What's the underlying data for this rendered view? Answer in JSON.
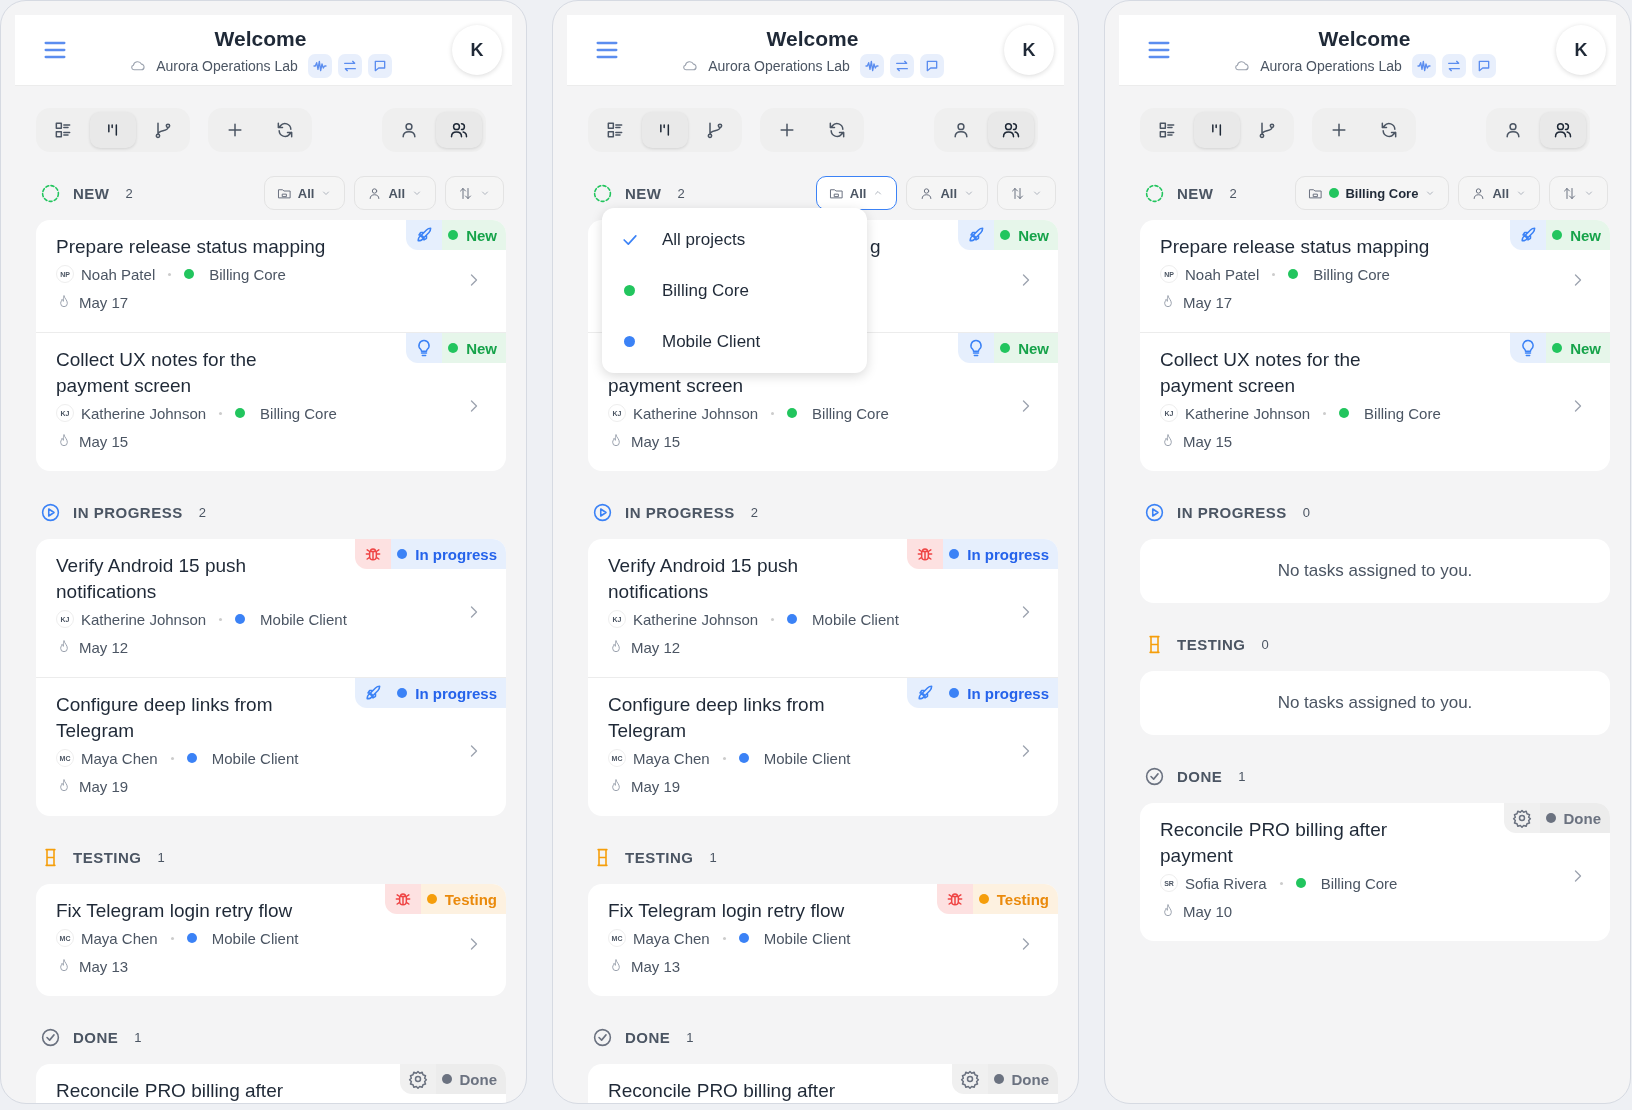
{
  "panels": [
    {
      "header": {
        "title": "Welcome",
        "workspace": "Aurora Operations Lab",
        "avatar": "K",
        "actions": [
          {
            "kind": "wave"
          },
          {
            "kind": "swap"
          },
          {
            "kind": "chat"
          }
        ]
      },
      "toolbar": [
        {
          "items": [
            {
              "kind": "list",
              "selected": false
            },
            {
              "kind": "board",
              "selected": true
            },
            {
              "kind": "branch",
              "selected": false
            }
          ]
        },
        {
          "items": [
            {
              "kind": "add",
              "selected": false
            },
            {
              "kind": "refresh",
              "selected": false
            }
          ]
        },
        {
          "items": [
            {
              "kind": "person",
              "selected": false
            },
            {
              "kind": "people",
              "selected": true
            }
          ]
        }
      ],
      "filters": {
        "project": {
          "value": "All",
          "open": false
        },
        "assignee": {
          "value": "All"
        }
      },
      "sections": [
        {
          "kind": "new",
          "label": "NEW",
          "count": "2",
          "tasks": [
            {
              "title": "Prepare release status mapping",
              "kind": "rocket",
              "status": {
                "kind": "new",
                "label": "New"
              },
              "initials": "NP",
              "assignee": "Noah Patel",
              "project": "Billing Core",
              "color": "#22c55e",
              "date": "May 17"
            },
            {
              "title": "Collect UX notes for the payment screen",
              "kind": "bulb",
              "status": {
                "kind": "new",
                "label": "New"
              },
              "initials": "KJ",
              "assignee": "Katherine Johnson",
              "project": "Billing Core",
              "color": "#22c55e",
              "date": "May 15"
            }
          ]
        },
        {
          "kind": "progress",
          "label": "IN PROGRESS",
          "count": "2",
          "tasks": [
            {
              "title": "Verify Android 15 push notifications",
              "kind": "bug",
              "status": {
                "kind": "progress",
                "label": "In progress"
              },
              "initials": "KJ",
              "assignee": "Katherine Johnson",
              "project": "Mobile Client",
              "color": "#3b82f6",
              "date": "May 12"
            },
            {
              "title": "Configure deep links from Telegram",
              "kind": "rocket",
              "status": {
                "kind": "progress",
                "label": "In progress"
              },
              "initials": "MC",
              "assignee": "Maya Chen",
              "project": "Mobile Client",
              "color": "#3b82f6",
              "date": "May 19"
            }
          ]
        },
        {
          "kind": "testing",
          "label": "TESTING",
          "count": "1",
          "tasks": [
            {
              "title": "Fix Telegram login retry flow",
              "kind": "bug",
              "status": {
                "kind": "testing",
                "label": "Testing"
              },
              "initials": "MC",
              "assignee": "Maya Chen",
              "project": "Mobile Client",
              "color": "#3b82f6",
              "date": "May 13"
            }
          ]
        },
        {
          "kind": "done",
          "label": "DONE",
          "count": "1",
          "tasks": [
            {
              "title": "Reconcile PRO billing after",
              "kind": "gear",
              "status": {
                "kind": "done",
                "label": "Done"
              }
            }
          ]
        }
      ]
    },
    {
      "header": {
        "title": "Welcome",
        "workspace": "Aurora Operations Lab",
        "avatar": "K",
        "actions": [
          {
            "kind": "wave"
          },
          {
            "kind": "swap"
          },
          {
            "kind": "chat"
          }
        ]
      },
      "toolbar": [
        {
          "items": [
            {
              "kind": "list",
              "selected": false
            },
            {
              "kind": "board",
              "selected": true
            },
            {
              "kind": "branch",
              "selected": false
            }
          ]
        },
        {
          "items": [
            {
              "kind": "add",
              "selected": false
            },
            {
              "kind": "refresh",
              "selected": false
            }
          ]
        },
        {
          "items": [
            {
              "kind": "person",
              "selected": false
            },
            {
              "kind": "people",
              "selected": true
            }
          ]
        }
      ],
      "filters": {
        "project": {
          "value": "All",
          "open": true
        },
        "assignee": {
          "value": "All"
        }
      },
      "dropdown": [
        {
          "label": "All projects",
          "selected": true
        },
        {
          "label": "Billing Core",
          "selected": false,
          "color": "#22c55e"
        },
        {
          "label": "Mobile Client",
          "selected": false,
          "color": "#3b82f6"
        }
      ],
      "sections": [
        {
          "kind": "new",
          "label": "NEW",
          "count": "2",
          "tasks": [
            {
              "title": "g",
              "kind": "rocket",
              "status": {
                "kind": "new",
                "label": "New"
              }
            },
            {
              "title": "payment screen",
              "kind": "bulb",
              "status": {
                "kind": "new",
                "label": "New"
              },
              "initials": "KJ",
              "assignee": "Katherine Johnson",
              "project": "Billing Core",
              "color": "#22c55e",
              "date": "May 15"
            }
          ]
        },
        {
          "kind": "progress",
          "label": "IN PROGRESS",
          "count": "2",
          "tasks": [
            {
              "title": "Verify Android 15 push notifications",
              "kind": "bug",
              "status": {
                "kind": "progress",
                "label": "In progress"
              },
              "initials": "KJ",
              "assignee": "Katherine Johnson",
              "project": "Mobile Client",
              "color": "#3b82f6",
              "date": "May 12"
            },
            {
              "title": "Configure deep links from Telegram",
              "kind": "rocket",
              "status": {
                "kind": "progress",
                "label": "In progress"
              },
              "initials": "MC",
              "assignee": "Maya Chen",
              "project": "Mobile Client",
              "color": "#3b82f6",
              "date": "May 19"
            }
          ]
        },
        {
          "kind": "testing",
          "label": "TESTING",
          "count": "1",
          "tasks": [
            {
              "title": "Fix Telegram login retry flow",
              "kind": "bug",
              "status": {
                "kind": "testing",
                "label": "Testing"
              },
              "initials": "MC",
              "assignee": "Maya Chen",
              "project": "Mobile Client",
              "color": "#3b82f6",
              "date": "May 13"
            }
          ]
        },
        {
          "kind": "done",
          "label": "DONE",
          "count": "1",
          "tasks": [
            {
              "title": "Reconcile PRO billing after",
              "kind": "gear",
              "status": {
                "kind": "done",
                "label": "Done"
              }
            }
          ]
        }
      ]
    },
    {
      "header": {
        "title": "Welcome",
        "workspace": "Aurora Operations Lab",
        "avatar": "K",
        "actions": [
          {
            "kind": "wave"
          },
          {
            "kind": "swap"
          },
          {
            "kind": "chat"
          }
        ]
      },
      "toolbar": [
        {
          "items": [
            {
              "kind": "list",
              "selected": false
            },
            {
              "kind": "board",
              "selected": true
            },
            {
              "kind": "branch",
              "selected": false
            }
          ]
        },
        {
          "items": [
            {
              "kind": "add",
              "selected": false
            },
            {
              "kind": "refresh",
              "selected": false
            }
          ]
        },
        {
          "items": [
            {
              "kind": "person",
              "selected": false
            },
            {
              "kind": "people",
              "selected": true
            }
          ]
        }
      ],
      "filters": {
        "project": {
          "value": "Billing Core",
          "color": "#22c55e",
          "open": false
        },
        "assignee": {
          "value": "All"
        }
      },
      "sections": [
        {
          "kind": "new",
          "label": "NEW",
          "count": "2",
          "tasks": [
            {
              "title": "Prepare release status mapping",
              "kind": "rocket",
              "status": {
                "kind": "new",
                "label": "New"
              },
              "initials": "NP",
              "assignee": "Noah Patel",
              "project": "Billing Core",
              "color": "#22c55e",
              "date": "May 17"
            },
            {
              "title": "Collect UX notes for the payment screen",
              "kind": "bulb",
              "status": {
                "kind": "new",
                "label": "New"
              },
              "initials": "KJ",
              "assignee": "Katherine Johnson",
              "project": "Billing Core",
              "color": "#22c55e",
              "date": "May 15"
            }
          ]
        },
        {
          "kind": "progress",
          "label": "IN PROGRESS",
          "count": "0",
          "empty": "No tasks assigned to you."
        },
        {
          "kind": "testing",
          "label": "TESTING",
          "count": "0",
          "empty": "No tasks assigned to you."
        },
        {
          "kind": "done",
          "label": "DONE",
          "count": "1",
          "tasks": [
            {
              "title": "Reconcile PRO billing after payment",
              "kind": "gear",
              "status": {
                "kind": "done",
                "label": "Done"
              },
              "initials": "SR",
              "assignee": "Sofia Rivera",
              "project": "Billing Core",
              "color": "#22c55e",
              "date": "May 10"
            }
          ]
        }
      ]
    }
  ]
}
